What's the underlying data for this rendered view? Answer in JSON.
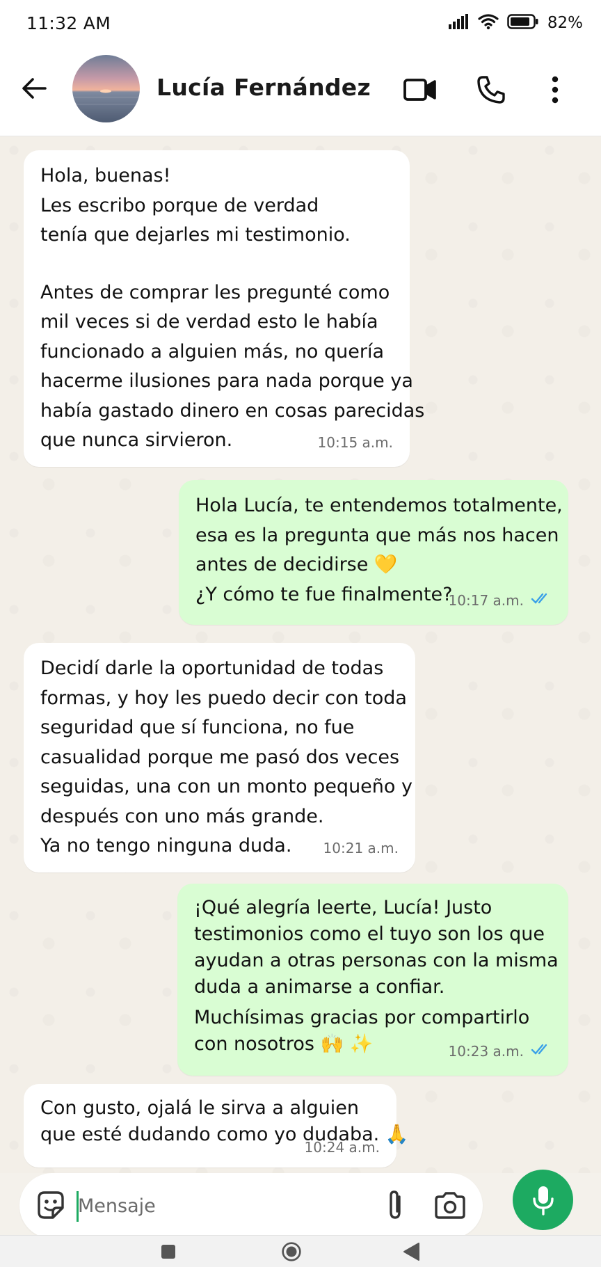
{
  "status_bar": {
    "time": "11:32 AM",
    "battery_percent": "82%"
  },
  "header": {
    "contact_name": "Lucía Fernández",
    "icons": [
      "back-arrow-icon",
      "video-call-icon",
      "phone-call-icon",
      "more-options-icon"
    ]
  },
  "messages": [
    {
      "direction": "incoming",
      "lines": [
        "Hola, buenas!",
        "Les escribo porque de verdad",
        "tenía que dejarles mi testimonio.",
        "",
        "Antes de comprar les pregunté como",
        "mil veces si de verdad esto le había",
        "funcionado a alguien más, no quería",
        "hacerme ilusiones para nada porque ya",
        "había gastado dinero en cosas parecidas",
        "que nunca sirvieron."
      ],
      "time": "10:15 a.m."
    },
    {
      "direction": "outgoing",
      "lines": [
        "Hola Lucía, te entendemos totalmente,",
        "esa es la pregunta que más nos hacen",
        "antes de decidirse 💛",
        "¿Y cómo te fue finalmente?"
      ],
      "time": "10:17 a.m.",
      "read": true
    },
    {
      "direction": "incoming",
      "lines": [
        "Decidí darle la oportunidad de todas",
        "formas, y hoy les puedo decir con toda",
        "seguridad que sí funciona, no fue",
        "casualidad porque me pasó dos veces",
        "seguidas, una con un monto pequeño y",
        "después con uno más grande.",
        "Ya no tengo ninguna duda."
      ],
      "time": "10:21 a.m."
    },
    {
      "direction": "outgoing",
      "lines": [
        "¡Qué alegría leerte, Lucía! Justo",
        "testimonios como el tuyo son los que",
        "ayudan a otras personas con la misma",
        "duda a animarse a confiar.",
        "Muchísimas gracias por compartirlo",
        "con nosotros 🙌 ✨"
      ],
      "time": "10:23 a.m.",
      "read": true
    },
    {
      "direction": "incoming",
      "lines": [
        "Con gusto, ojalá le sirva a alguien",
        "que esté dudando como yo dudaba. 🙏"
      ],
      "time": "10:24 a.m."
    }
  ],
  "composer": {
    "placeholder": "Mensaje",
    "icons": [
      "emoji-sticker-icon",
      "attach-clip-icon",
      "camera-icon",
      "microphone-icon"
    ]
  },
  "colors": {
    "incoming_bubble": "#ffffff",
    "outgoing_bubble": "#d9fdd3",
    "accent_green": "#1daa61",
    "read_ticks": "#3aa0e8",
    "chat_background": "#f3efe8"
  }
}
